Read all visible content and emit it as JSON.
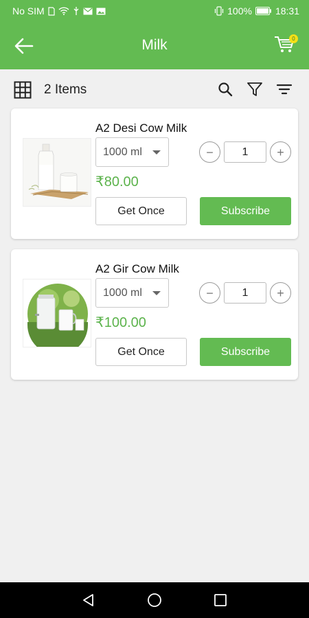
{
  "status": {
    "carrier": "No SIM",
    "battery": "100%",
    "time": "18:31"
  },
  "header": {
    "title": "Milk",
    "cart_count": "0"
  },
  "toolbar": {
    "items_count": "2 Items"
  },
  "products": [
    {
      "name": "A2 Desi Cow Milk",
      "size": "1000 ml",
      "qty": "1",
      "price": "₹80.00",
      "get_once": "Get Once",
      "subscribe": "Subscribe"
    },
    {
      "name": "A2 Gir Cow Milk",
      "size": "1000 ml",
      "qty": "1",
      "price": "₹100.00",
      "get_once": "Get Once",
      "subscribe": "Subscribe"
    }
  ],
  "qty_controls": {
    "minus": "−",
    "plus": "+"
  },
  "colors": {
    "primary": "#63bb52",
    "price": "#5cb34c",
    "badge": "#f4e016"
  },
  "icons": [
    "back-arrow-icon",
    "cart-icon",
    "grid-icon",
    "search-icon",
    "filter-icon",
    "sort-icon",
    "nav-back-icon",
    "nav-home-icon",
    "nav-recents-icon"
  ]
}
